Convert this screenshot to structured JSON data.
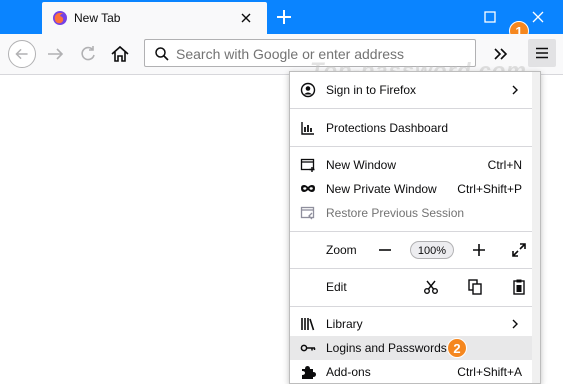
{
  "tab": {
    "title": "New Tab",
    "favicon": "firefox-logo-icon"
  },
  "navbar": {
    "search_placeholder": "Search with Google or enter address"
  },
  "badges": {
    "step1": "1",
    "step2": "2"
  },
  "watermark": "Top-password.com",
  "menu": {
    "sign_in": "Sign in to Firefox",
    "protections": "Protections Dashboard",
    "new_window": "New Window",
    "new_window_shortcut": "Ctrl+N",
    "new_private": "New Private Window",
    "new_private_shortcut": "Ctrl+Shift+P",
    "restore_session": "Restore Previous Session",
    "zoom_label": "Zoom",
    "zoom_value": "100%",
    "edit_label": "Edit",
    "library": "Library",
    "logins": "Logins and Passwords",
    "addons": "Add-ons",
    "addons_shortcut": "Ctrl+Shift+A"
  },
  "colors": {
    "titlebar": "#0a84ff",
    "badge": "#f5871f",
    "hover": "#e8e8e9"
  }
}
